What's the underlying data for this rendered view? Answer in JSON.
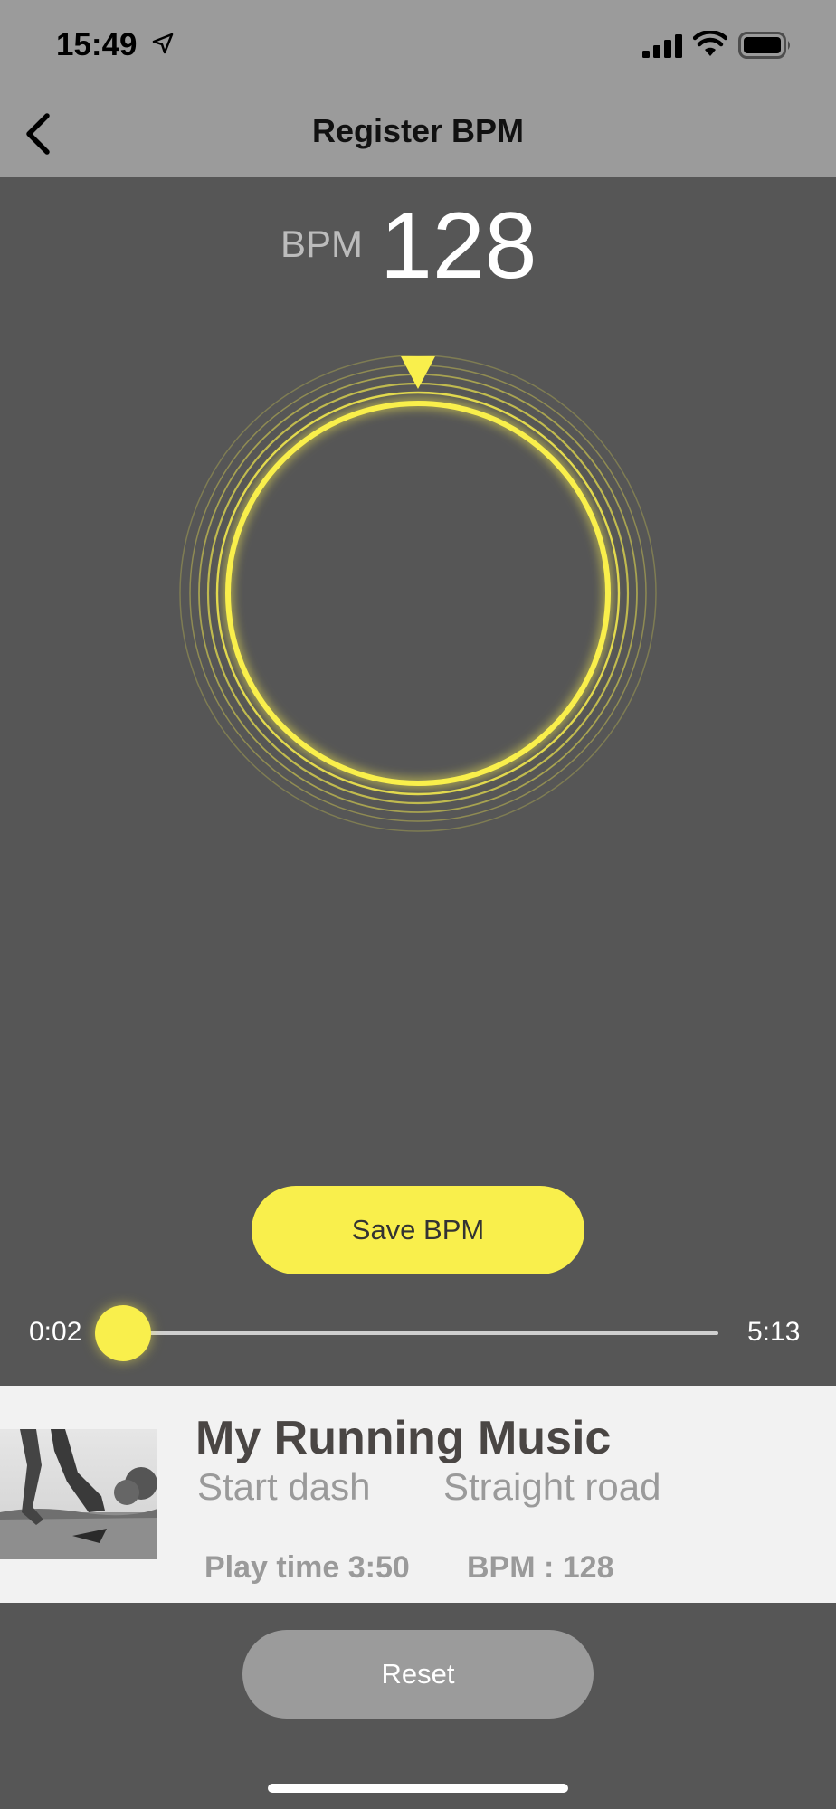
{
  "status_bar": {
    "time": "15:49",
    "icons": [
      "location-arrow-icon",
      "signal-icon",
      "wifi-icon",
      "battery-icon"
    ]
  },
  "nav": {
    "title": "Register BPM",
    "back_icon": "chevron-left-icon"
  },
  "bpm": {
    "label": "BPM",
    "value": "128"
  },
  "ring": {
    "indicator_icon": "triangle-marker-icon",
    "color": "#f9ef4c"
  },
  "save_button": {
    "label": "Save BPM"
  },
  "progress": {
    "elapsed": "0:02",
    "total": "5:13",
    "fraction": 0.0064
  },
  "music_card": {
    "title": "My Running Music",
    "tags": [
      "Start dash",
      "Straight road"
    ],
    "play_time": "Play time 3:50",
    "bpm_text": "BPM : 128",
    "cover_icon": "runner-photo"
  },
  "reset_button": {
    "label": "Reset"
  },
  "colors": {
    "accent": "#f9ef4c",
    "header_bg": "#9b9b9b",
    "body_bg": "#565656",
    "card_bg": "#f2f2f2"
  }
}
